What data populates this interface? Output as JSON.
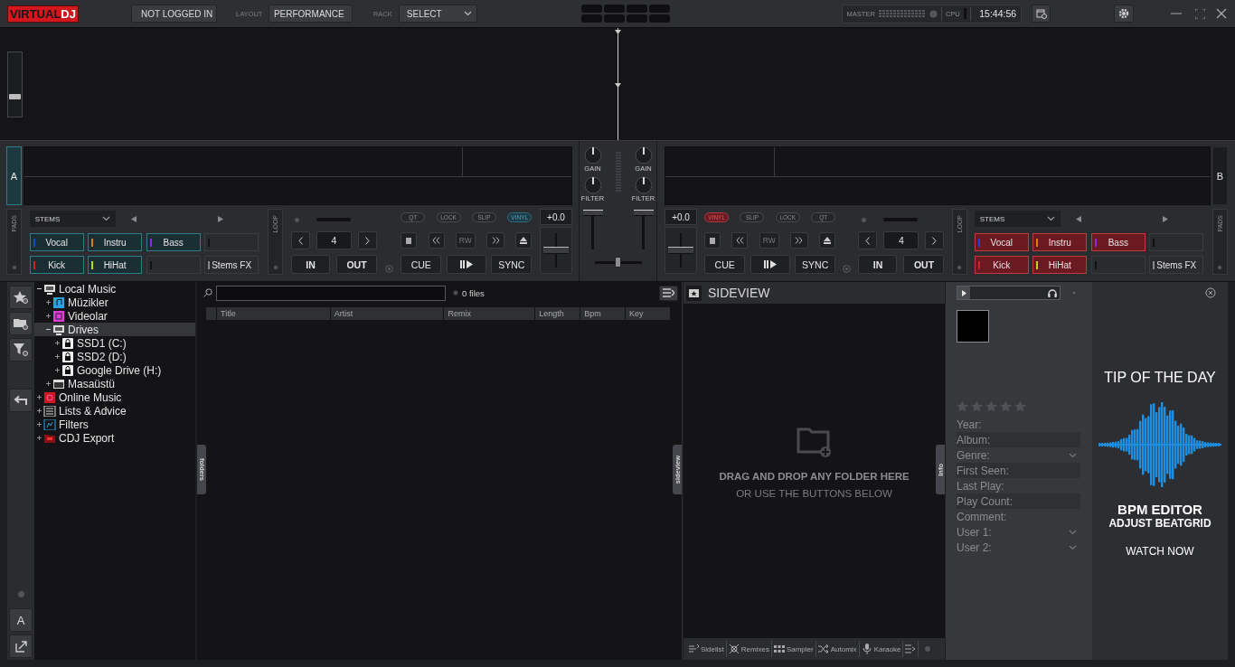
{
  "top_bar": {
    "logo": {
      "word_1": "VIRTUAL",
      "word_2": "DJ"
    },
    "login": "NOT LOGGED IN",
    "layout": {
      "label": "LAYOUT",
      "value": "PERFORMANCE"
    },
    "rack": {
      "label": "RACK",
      "value": "SELECT"
    },
    "master_label": "MASTER",
    "cpu_label": "CPU",
    "clock": "15:44:56"
  },
  "decks": [
    {
      "letter": "A",
      "pads_label": "PADS",
      "loop_label": "LOOP",
      "stems_menu": "STEMS",
      "pads": [
        {
          "kind": "stem",
          "label": "Vocal",
          "color": "#2440d0"
        },
        {
          "kind": "stem",
          "label": "Instru",
          "color": "#e07a1a"
        },
        {
          "kind": "stem",
          "label": "Bass",
          "color": "#8a2be2"
        },
        {
          "kind": "empty"
        },
        {
          "kind": "stem",
          "label": "Kick",
          "color": "#d0202a"
        },
        {
          "kind": "stem",
          "label": "HiHat",
          "color": "#c8d21a"
        },
        {
          "kind": "empty"
        },
        {
          "kind": "fx",
          "label": "Stems FX"
        }
      ],
      "loop": {
        "size": "4",
        "in": "IN",
        "out": "OUT",
        "level": 0
      },
      "toggles": [
        {
          "label": "QT",
          "on": false
        },
        {
          "label": "LOCK",
          "on": false
        },
        {
          "label": "SLIP",
          "on": false
        },
        {
          "label": "VINYL",
          "on": true
        }
      ],
      "transport": {
        "rewind": "RW",
        "cue": "CUE",
        "sync": "SYNC"
      },
      "pitch": "+0.0",
      "pitch_slider": {
        "level": 0.5
      }
    },
    {
      "letter": "B",
      "pads_label": "PADS",
      "loop_label": "LOOP",
      "stems_menu": "STEMS",
      "pads": [
        {
          "kind": "stem",
          "label": "Vocal",
          "color": "#2440d0"
        },
        {
          "kind": "stem",
          "label": "Instru",
          "color": "#e07a1a"
        },
        {
          "kind": "stem",
          "label": "Bass",
          "color": "#8a2be2"
        },
        {
          "kind": "empty"
        },
        {
          "kind": "stem",
          "label": "Kick",
          "color": "#d0202a"
        },
        {
          "kind": "stem",
          "label": "HiHat",
          "color": "#c8d21a"
        },
        {
          "kind": "empty"
        },
        {
          "kind": "fx",
          "label": "Stems FX"
        }
      ],
      "loop": {
        "size": "4",
        "in": "IN",
        "out": "OUT",
        "level": 0
      },
      "toggles": [
        {
          "label": "VINYL",
          "on": true
        },
        {
          "label": "SLIP",
          "on": false
        },
        {
          "label": "LOCK",
          "on": false
        },
        {
          "label": "QT",
          "on": false
        }
      ],
      "transport": {
        "rewind": "RW",
        "cue": "CUE",
        "sync": "SYNC"
      },
      "pitch": "+0.0",
      "pitch_slider": {
        "level": 0.5
      }
    }
  ],
  "overview": {
    "zoom_slider": {
      "level": 0.3
    }
  },
  "mixer": {
    "channels": [
      {
        "gain": "GAIN",
        "filter": "FILTER",
        "level": 1
      },
      {
        "gain": "GAIN",
        "filter": "FILTER",
        "level": 1
      }
    ],
    "crossfader": {
      "level": 0.5
    }
  },
  "browser": {
    "text_size_label": "A",
    "tree": [
      {
        "label": "Local Music",
        "kind": "computer",
        "expanded": true,
        "selected": false,
        "children": [
          {
            "label": "Müzikler",
            "kind": "music",
            "expanded": false,
            "selected": false
          },
          {
            "label": "Videolar",
            "kind": "video",
            "expanded": false,
            "selected": false
          },
          {
            "label": "Drives",
            "kind": "computer",
            "expanded": true,
            "selected": true,
            "children": [
              {
                "label": "SSD1 (C:)",
                "kind": "drive",
                "expanded": false,
                "selected": false
              },
              {
                "label": "SSD2 (D:)",
                "kind": "drive",
                "expanded": false,
                "selected": false
              },
              {
                "label": "Google Drive (H:)",
                "kind": "drive",
                "expanded": false,
                "selected": false
              }
            ]
          },
          {
            "label": "Masaüstü",
            "kind": "desktop",
            "expanded": false,
            "selected": false
          }
        ]
      },
      {
        "label": "Online Music",
        "kind": "online",
        "expanded": false,
        "selected": false
      },
      {
        "label": "Lists & Advice",
        "kind": "list",
        "expanded": false,
        "selected": false
      },
      {
        "label": "Filters",
        "kind": "filter",
        "expanded": false,
        "selected": false
      },
      {
        "label": "CDJ Export",
        "kind": "export",
        "expanded": false,
        "selected": false
      }
    ],
    "files": {
      "count": "0 files",
      "columns": [
        "Title",
        "Artist",
        "Remix",
        "Length",
        "Bpm",
        "Key"
      ]
    },
    "side_tabs": {
      "folders": "folders",
      "sideview": "sideview",
      "info": "Info"
    }
  },
  "sideview": {
    "title": "SIDEVIEW",
    "message": "DRAG AND DROP ANY FOLDER HERE",
    "hint": "OR USE THE BUTTONS BELOW",
    "tabs": [
      {
        "label": "Sidelist",
        "kind": "sidelist"
      },
      {
        "label": "Remixes",
        "kind": "remixes"
      },
      {
        "label": "Sampler",
        "kind": "sampler"
      },
      {
        "label": "Automix",
        "kind": "automix"
      },
      {
        "label": "Karaoke",
        "kind": "karaoke"
      }
    ]
  },
  "info": {
    "stars": 0,
    "fields": [
      {
        "label": "Year:",
        "kind": "plain"
      },
      {
        "label": "Album:",
        "kind": "field"
      },
      {
        "label": "Genre:",
        "kind": "dropdown"
      },
      {
        "label": "First Seen:",
        "kind": "field"
      },
      {
        "label": "Last Play:",
        "kind": "plain"
      },
      {
        "label": "Play Count:",
        "kind": "field"
      },
      {
        "label": "Comment:",
        "kind": "plain"
      },
      {
        "label": "User 1:",
        "kind": "dropdown"
      },
      {
        "label": "User 2:",
        "kind": "dropdown"
      }
    ],
    "tip": {
      "heading": "TIP OF THE DAY",
      "title": "BPM EDITOR",
      "subtitle": "ADJUST BEATGRID",
      "action": "WATCH NOW"
    }
  }
}
